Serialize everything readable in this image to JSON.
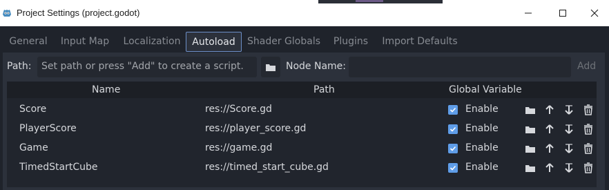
{
  "window": {
    "title": "Project Settings (project.godot)",
    "minimize_icon": "minimize-icon",
    "maximize_icon": "maximize-icon",
    "close_icon": "close-icon"
  },
  "tabs": [
    {
      "label": "General",
      "active": false
    },
    {
      "label": "Input Map",
      "active": false
    },
    {
      "label": "Localization",
      "active": false
    },
    {
      "label": "Autoload",
      "active": true
    },
    {
      "label": "Shader Globals",
      "active": false
    },
    {
      "label": "Plugins",
      "active": false
    },
    {
      "label": "Import Defaults",
      "active": false
    }
  ],
  "autoload": {
    "path_label": "Path:",
    "path_placeholder": "Set path or press \"Add\" to create a script.",
    "node_name_label": "Node Name:",
    "node_name_value": "",
    "add_label": "Add"
  },
  "table": {
    "headers": {
      "name": "Name",
      "path": "Path",
      "global": "Global Variable"
    },
    "rows": [
      {
        "name": "Score",
        "path": "res://Score.gd",
        "enabled": true,
        "enable_label": "Enable"
      },
      {
        "name": "PlayerScore",
        "path": "res://player_score.gd",
        "enabled": true,
        "enable_label": "Enable"
      },
      {
        "name": "Game",
        "path": "res://game.gd",
        "enabled": true,
        "enable_label": "Enable"
      },
      {
        "name": "TimedStartCube",
        "path": "res://timed_start_cube.gd",
        "enabled": true,
        "enable_label": "Enable"
      }
    ],
    "row_actions": [
      "folder-icon",
      "move-up-icon",
      "move-down-icon",
      "delete-icon"
    ]
  },
  "colors": {
    "accent": "#5f9de8",
    "panel": "#2c313b",
    "background": "#1f232b"
  }
}
